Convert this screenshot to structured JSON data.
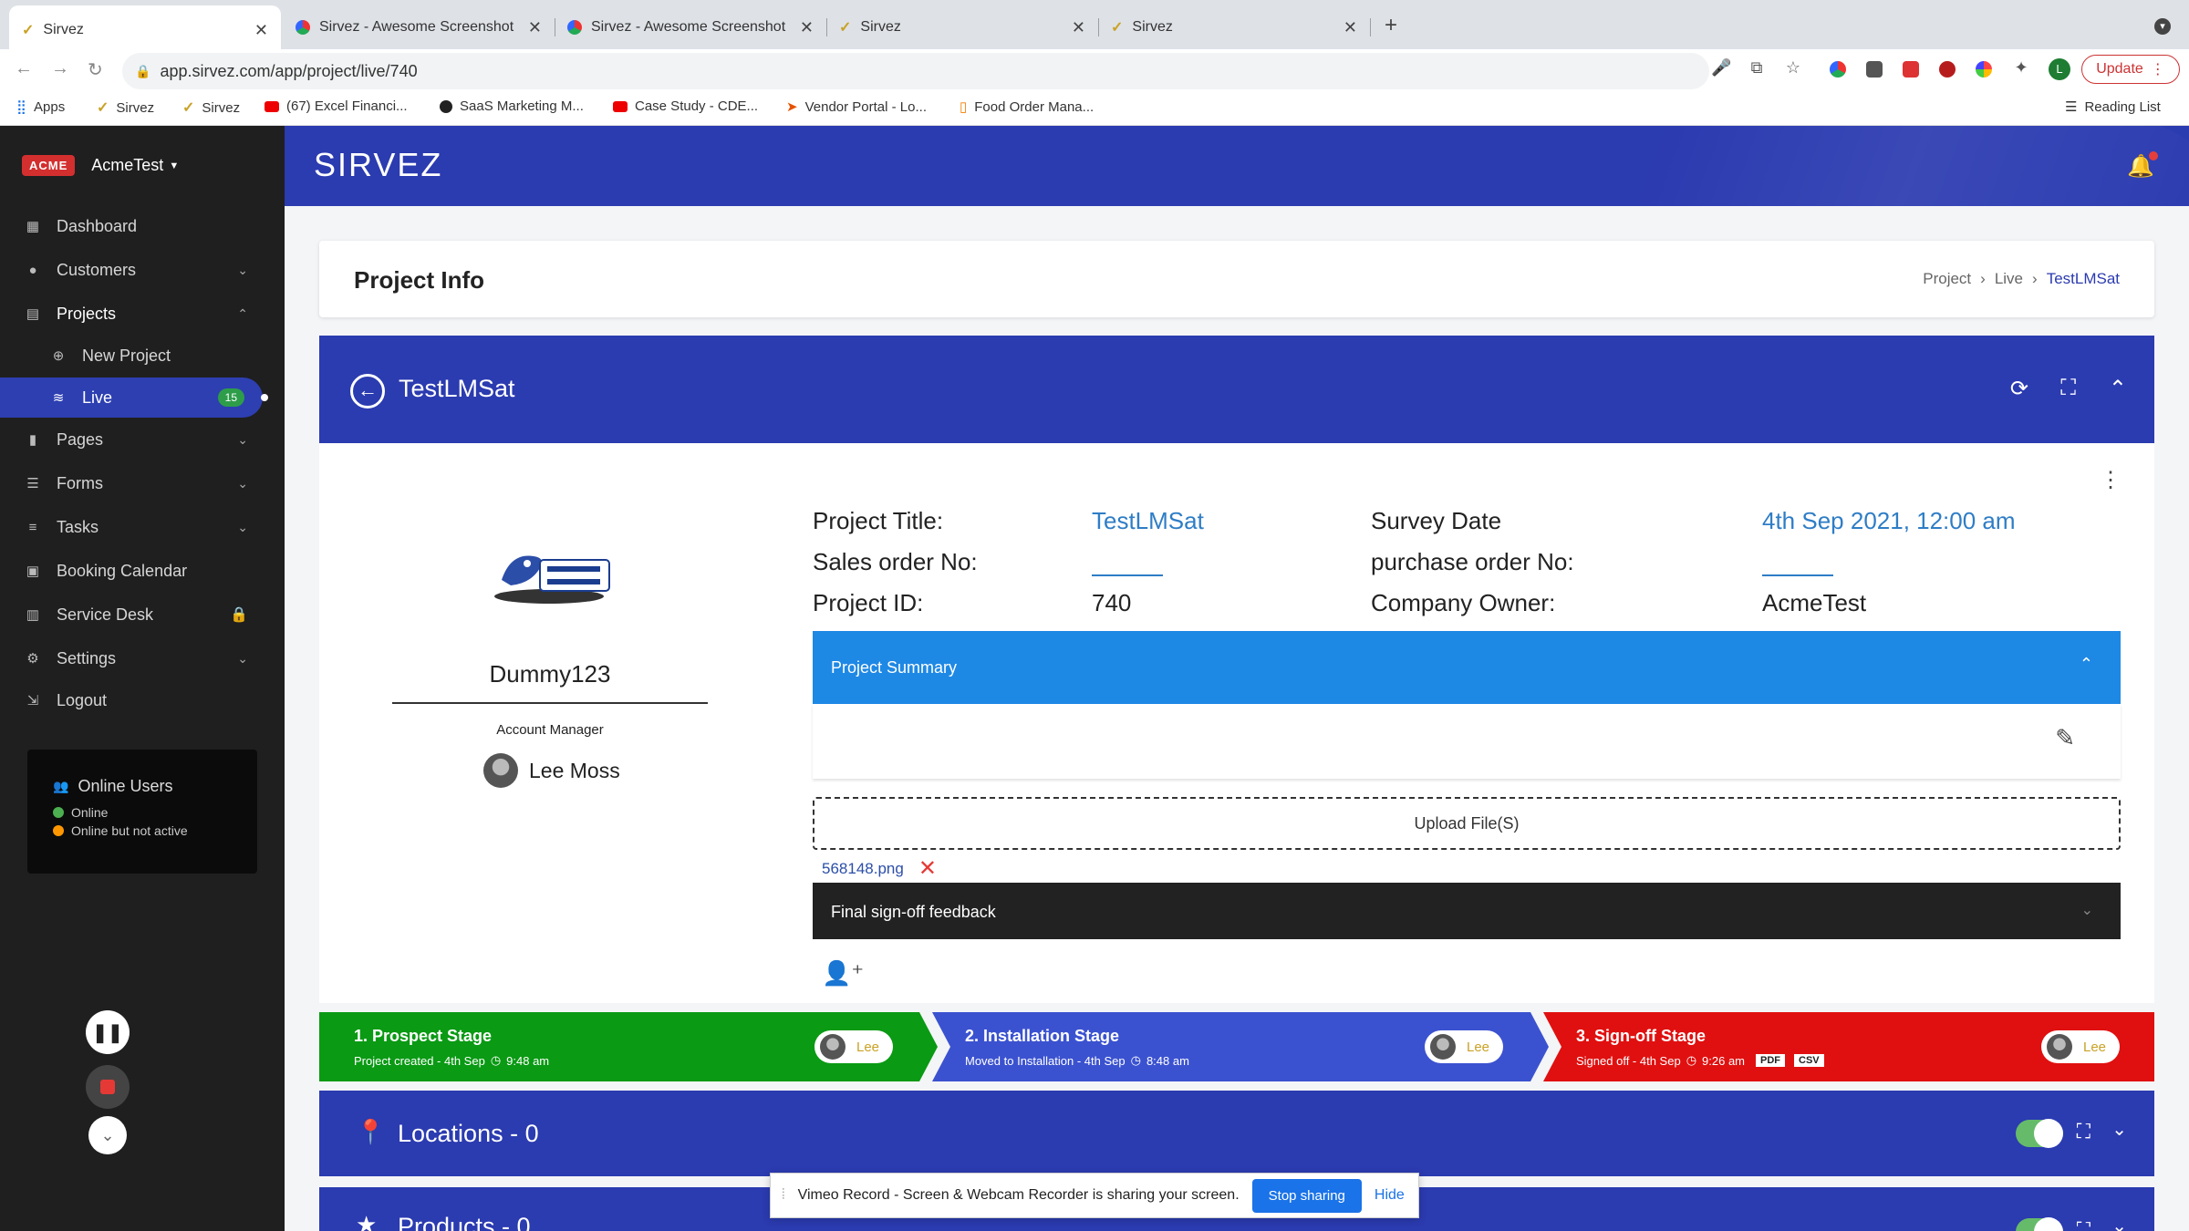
{
  "browser": {
    "tabs": [
      {
        "title": "Sirvez"
      },
      {
        "title": "Sirvez - Awesome Screenshot"
      },
      {
        "title": "Sirvez - Awesome Screenshot"
      },
      {
        "title": "Sirvez"
      },
      {
        "title": "Sirvez"
      }
    ],
    "url": "app.sirvez.com/app/project/live/740",
    "update_label": "Update",
    "profile_initial": "L",
    "bookmarks": [
      "Apps",
      "Sirvez",
      "Sirvez",
      "(67) Excel Financi...",
      "SaaS Marketing M...",
      "Case Study - CDE...",
      "Vendor Portal - Lo...",
      "Food Order Mana..."
    ],
    "reading_list": "Reading List"
  },
  "sidebar": {
    "brand_logo": "ACME",
    "account": "AcmeTest",
    "items": [
      {
        "label": "Dashboard",
        "icon": "dashboard-icon"
      },
      {
        "label": "Customers",
        "icon": "customers-icon"
      },
      {
        "label": "Projects",
        "icon": "projects-icon"
      },
      {
        "label": "New Project",
        "icon": "plus-circle-icon"
      },
      {
        "label": "Live",
        "icon": "wifi-icon",
        "badge": "15"
      },
      {
        "label": "Pages",
        "icon": "pages-icon"
      },
      {
        "label": "Forms",
        "icon": "forms-icon"
      },
      {
        "label": "Tasks",
        "icon": "tasks-icon"
      },
      {
        "label": "Booking Calendar",
        "icon": "calendar-icon"
      },
      {
        "label": "Service Desk",
        "icon": "service-desk-icon"
      },
      {
        "label": "Settings",
        "icon": "settings-icon"
      },
      {
        "label": "Logout",
        "icon": "logout-icon"
      }
    ],
    "online": {
      "title": "Online Users",
      "online_label": "Online",
      "inactive_label": "Online but not active",
      "online_color": "#4caf50",
      "inactive_color": "#ff9800"
    }
  },
  "header": {
    "logo": "SIRVEZ"
  },
  "page": {
    "title": "Project Info",
    "breadcrumb": [
      "Project",
      "Live",
      "TestLMSat"
    ]
  },
  "project": {
    "name": "TestLMSat",
    "customer": "Dummy123",
    "account_manager_label": "Account Manager",
    "account_manager": "Lee Moss",
    "fields": {
      "title_label": "Project Title:",
      "title_value": "TestLMSat",
      "survey_label": "Survey Date",
      "survey_value": "4th Sep 2021, 12:00 am",
      "sales_label": "Sales order No:",
      "purchase_label": "purchase order No:",
      "id_label": "Project ID:",
      "id_value": "740",
      "owner_label": "Company Owner:",
      "owner_value": "AcmeTest"
    },
    "summary_label": "Project Summary",
    "upload_label": "Upload File(S)",
    "file_name": "568148.png",
    "signoff_label": "Final sign-off feedback"
  },
  "stages": [
    {
      "title": "1. Prospect Stage",
      "detail": "Project created - 4th Sep",
      "time": "9:48 am",
      "user": "Lee",
      "color": "#0a9a14"
    },
    {
      "title": "2. Installation Stage",
      "detail": "Moved to Installation - 4th Sep",
      "time": "8:48 am",
      "user": "Lee",
      "color": "#3b52d0"
    },
    {
      "title": "3. Sign-off Stage",
      "detail": "Signed off - 4th Sep",
      "time": "9:26 am",
      "user": "Lee",
      "color": "#e01010",
      "tags": [
        "PDF",
        "CSV"
      ]
    }
  ],
  "sections": [
    {
      "title": "Locations - 0"
    },
    {
      "title": "Products - 0"
    }
  ],
  "vimeo_bar": {
    "message": "Vimeo Record - Screen & Webcam Recorder is sharing your screen.",
    "stop_label": "Stop sharing",
    "hide_label": "Hide"
  }
}
